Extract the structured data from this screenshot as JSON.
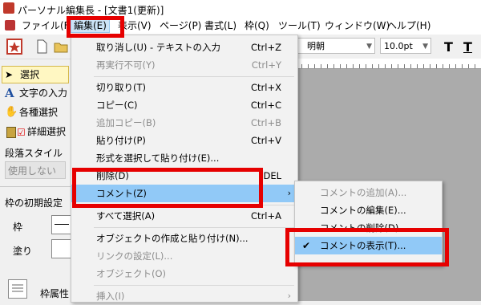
{
  "window": {
    "title": "パーソナル編集長 - [文書1(更新)]"
  },
  "menubar": {
    "items": [
      {
        "label": "ファイル(F)"
      },
      {
        "label": "編集(E)"
      },
      {
        "label": "表示(V)"
      },
      {
        "label": "ページ(P)"
      },
      {
        "label": "書式(L)"
      },
      {
        "label": "枠(Q)"
      },
      {
        "label": "ツール(T)"
      },
      {
        "label": "ウィンドウ(W)"
      },
      {
        "label": "ヘルプ(H)"
      }
    ]
  },
  "toolbar": {
    "font": "明朝",
    "font_size": "10.0pt",
    "bold_glyph": "T",
    "t2_glyph": "T"
  },
  "left_panel": {
    "tools": [
      {
        "label": "選択",
        "icon": "arrow-icon"
      },
      {
        "label": "文字の入力",
        "icon": "text-icon"
      },
      {
        "label": "各種選択",
        "icon": "hand-icon"
      },
      {
        "label": "詳細選択",
        "icon": "lock-icon"
      }
    ],
    "paragraph_style_label": "段落スタイル",
    "paragraph_style_value": "使用しない",
    "frame_settings_label": "枠の初期設定",
    "frame_label": "枠",
    "fill_label": "塗り",
    "frame_props_label": "枠属性"
  },
  "edit_menu": {
    "items": [
      {
        "label": "取り消し(U) - テキストの入力",
        "shortcut": "Ctrl+Z",
        "disabled": false
      },
      {
        "label": "再実行不可(Y)",
        "shortcut": "Ctrl+Y",
        "disabled": true
      },
      {
        "label": "切り取り(T)",
        "shortcut": "Ctrl+X",
        "disabled": false
      },
      {
        "label": "コピー(C)",
        "shortcut": "Ctrl+C",
        "disabled": false
      },
      {
        "label": "追加コピー(B)",
        "shortcut": "Ctrl+B",
        "disabled": true
      },
      {
        "label": "貼り付け(P)",
        "shortcut": "Ctrl+V",
        "disabled": false
      },
      {
        "label": "形式を選択して貼り付け(E)...",
        "shortcut": "",
        "disabled": false
      },
      {
        "label": "削除(D)",
        "shortcut": "DEL",
        "disabled": false
      },
      {
        "label": "コメント(Z)",
        "shortcut": "",
        "disabled": false
      },
      {
        "label": "すべて選択(A)",
        "shortcut": "Ctrl+A",
        "disabled": false
      },
      {
        "label": "オブジェクトの作成と貼り付け(N)...",
        "shortcut": "",
        "disabled": false
      },
      {
        "label": "リンクの設定(L)...",
        "shortcut": "",
        "disabled": true
      },
      {
        "label": "オブジェクト(O)",
        "shortcut": "",
        "disabled": true
      },
      {
        "label": "挿入(I)",
        "shortcut": "",
        "disabled": true
      }
    ]
  },
  "comment_submenu": {
    "items": [
      {
        "label": "コメントの追加(A)...",
        "disabled": true
      },
      {
        "label": "コメントの編集(E)...",
        "disabled": false
      },
      {
        "label": "コメントの削除(D)",
        "disabled": false
      },
      {
        "label": "コメントの表示(T)...",
        "disabled": false,
        "checked": true
      }
    ]
  },
  "colors": {
    "highlight": "#91c9f7",
    "annotation_red": "#e60000",
    "menu_bg": "#f2f2f2",
    "disabled_text": "#8d8d8d"
  }
}
